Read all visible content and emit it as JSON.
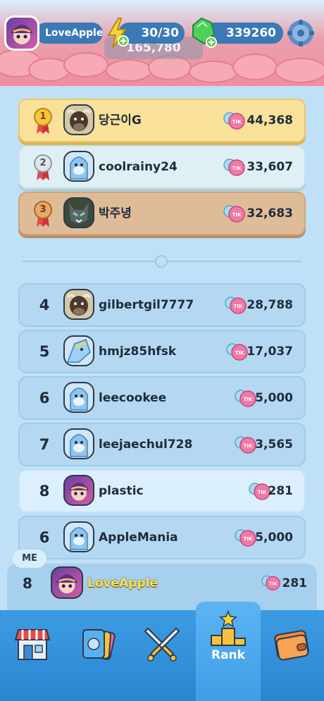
{
  "header": {
    "username": "LoveApple",
    "energy": "30/30",
    "gems": "339260",
    "pile_total": "165,780",
    "coin_label": "TIK"
  },
  "top_ranks": [
    {
      "rank": "1",
      "name": "당근이G",
      "score": "44,368",
      "medal": "gold"
    },
    {
      "rank": "2",
      "name": "coolrainy24",
      "score": "33,607",
      "medal": "silver"
    },
    {
      "rank": "3",
      "name": "박주녕",
      "score": "32,683",
      "medal": "bronze"
    }
  ],
  "ranks": [
    {
      "rank": "4",
      "name": "gilbertgil7777",
      "score": "28,788"
    },
    {
      "rank": "5",
      "name": "hmjz85hfsk",
      "score": "17,037"
    },
    {
      "rank": "6",
      "name": "leecookee",
      "score": "5,000"
    },
    {
      "rank": "7",
      "name": "leejaechul728",
      "score": "3,565"
    },
    {
      "rank": "8",
      "name": "plastic",
      "score": "281"
    },
    {
      "rank": "6",
      "name": "AppleMania",
      "score": "5,000"
    }
  ],
  "me": {
    "badge": "ME",
    "rank": "8",
    "name": "LoveApple",
    "score": "281"
  },
  "nav": {
    "items": [
      {
        "name": "shop",
        "label": ""
      },
      {
        "name": "cards",
        "label": ""
      },
      {
        "name": "battle",
        "label": ""
      },
      {
        "name": "rank",
        "label": "Rank"
      },
      {
        "name": "wallet",
        "label": ""
      }
    ]
  },
  "colors": {
    "background": "#bfe0f6",
    "gold": "#f9e19a",
    "silver": "#dff0f5",
    "bronze": "#dfbc98",
    "nav": "#2b86d2",
    "coin": "#f07aa6"
  }
}
